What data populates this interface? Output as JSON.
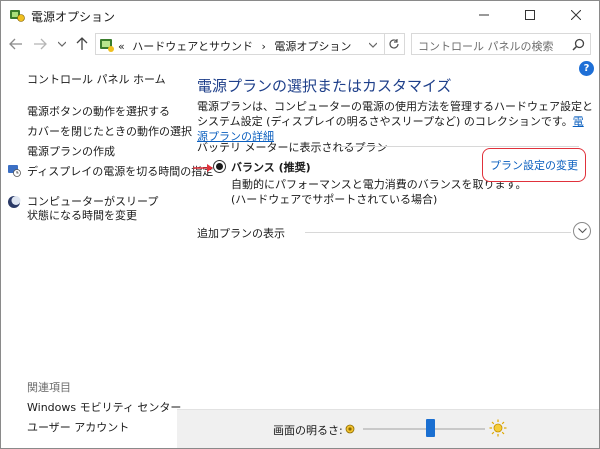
{
  "window": {
    "title": "電源オプション"
  },
  "nav": {
    "address_prefix": "«",
    "breadcrumb": [
      "ハードウェアとサウンド",
      "電源オプション"
    ],
    "breadcrumb_sep": "›",
    "search_placeholder": "コントロール パネルの検索"
  },
  "sidebar": {
    "home": "コントロール パネル ホーム",
    "items": [
      "電源ボタンの動作を選択する",
      "カバーを閉じたときの動作の選択",
      "電源プランの作成",
      "ディスプレイの電源を切る時間の指定",
      "コンピューターがスリープ状態になる時間を変更"
    ],
    "related_heading": "関連項目",
    "related": [
      "Windows モビリティ センター",
      "ユーザー アカウント"
    ]
  },
  "main": {
    "title": "電源プランの選択またはカスタマイズ",
    "description": "電源プランは、コンピューターの電源の使用方法を管理するハードウェア設定とシステム設定 (ディスプレイの明るさやスリープなど) のコレクションです。",
    "description_link": "電源プランの詳細",
    "group_title": "バッテリ メーターに表示されるプラン",
    "plan": {
      "name": "バランス (推奨)",
      "description": "自動的にパフォーマンスと電力消費のバランスを取ります。(ハードウェアでサポートされている場合)",
      "change_link": "プラン設定の変更",
      "selected": true
    },
    "additional_plans": "追加プランの表示"
  },
  "brightness": {
    "label": "画面の明るさ:",
    "level_fraction": 0.55
  },
  "colors": {
    "accent": "#1e3f8a",
    "link": "#0b5fbf",
    "highlight": "#e0313b"
  }
}
